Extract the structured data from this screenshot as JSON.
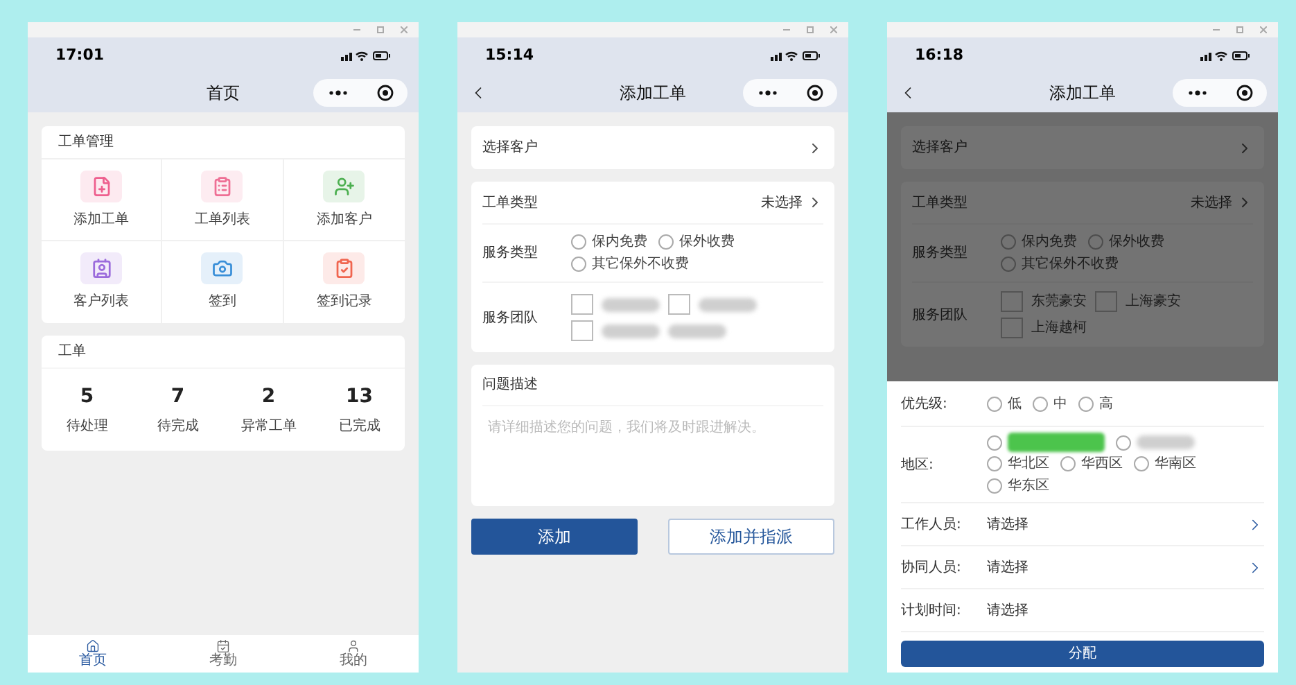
{
  "screens": [
    {
      "kind": "home",
      "status_time": "17:01",
      "title": "首页",
      "management": {
        "title": "工单管理",
        "items": [
          {
            "label": "添加工单",
            "color": "#ee5f8e"
          },
          {
            "label": "工单列表",
            "color": "#ee6f95"
          },
          {
            "label": "添加客户",
            "color": "#4caf50"
          },
          {
            "label": "客户列表",
            "color": "#9b6bdc"
          },
          {
            "label": "签到",
            "color": "#3a8fd8"
          },
          {
            "label": "签到记录",
            "color": "#f0654f"
          }
        ]
      },
      "orders": {
        "title": "工单",
        "stats": [
          {
            "value": "5",
            "label": "待处理"
          },
          {
            "value": "7",
            "label": "待完成"
          },
          {
            "value": "2",
            "label": "异常工单"
          },
          {
            "value": "13",
            "label": "已完成"
          }
        ]
      },
      "tabs": [
        {
          "label": "首页",
          "selected": true
        },
        {
          "label": "考勤",
          "selected": false
        },
        {
          "label": "我的",
          "selected": false
        }
      ]
    },
    {
      "kind": "form",
      "status_time": "15:14",
      "title": "添加工单",
      "customer": {
        "label": "选择客户"
      },
      "order_type": {
        "label": "工单类型",
        "value": "未选择"
      },
      "service_type": {
        "label": "服务类型",
        "options": [
          {
            "label": "保内免费",
            "selected": false
          },
          {
            "label": "保外收费",
            "selected": false
          },
          {
            "label": "其它保外不收费",
            "selected": false
          }
        ]
      },
      "team": {
        "label": "服务团队",
        "options": [
          {
            "kind": "redacted",
            "checked": false
          },
          {
            "kind": "redacted",
            "checked": false
          },
          {
            "kind": "redacted",
            "checked": false
          }
        ]
      },
      "description": {
        "label": "问题描述",
        "placeholder": "请详细描述您的问题，我们将及时跟进解决。"
      },
      "buttons": [
        {
          "label": "添加",
          "kind": "primary"
        },
        {
          "label": "添加并指派",
          "kind": "outline"
        }
      ]
    },
    {
      "kind": "assign",
      "status_time": "16:18",
      "title": "添加工单",
      "customer": {
        "label": "选择客户"
      },
      "order_type": {
        "label": "工单类型",
        "value": "未选择"
      },
      "service_type": {
        "label": "服务类型",
        "options": [
          {
            "label": "保内免费",
            "selected": false
          },
          {
            "label": "保外收费",
            "selected": false
          },
          {
            "label": "其它保外不收费",
            "selected": false
          }
        ]
      },
      "team": {
        "label": "服务团队",
        "options": [
          {
            "kind": "text",
            "label": "东莞豪安",
            "checked": false
          },
          {
            "kind": "text",
            "label": "上海豪安",
            "checked": false
          },
          {
            "kind": "text",
            "label": "上海越柯",
            "checked": false
          }
        ]
      },
      "sheet": {
        "priority": {
          "label": "优先级:",
          "options": [
            {
              "label": "低",
              "selected": false
            },
            {
              "label": "中",
              "selected": false
            },
            {
              "label": "高",
              "selected": false
            }
          ]
        },
        "region": {
          "label": "地区:",
          "options": [
            {
              "kind": "redacted_highlight",
              "selected": false
            },
            {
              "kind": "redacted",
              "selected": false
            },
            {
              "kind": "text",
              "label": "华北区",
              "selected": false
            },
            {
              "kind": "text",
              "label": "华西区",
              "selected": false
            },
            {
              "kind": "text",
              "label": "华南区",
              "selected": false
            },
            {
              "kind": "text",
              "label": "华东区",
              "selected": false
            }
          ]
        },
        "pickers": [
          {
            "label": "工作人员:",
            "value": "请选择",
            "arrow": true
          },
          {
            "label": "协同人员:",
            "value": "请选择",
            "arrow": true
          },
          {
            "label": "计划时间:",
            "value": "请选择",
            "arrow": false
          }
        ],
        "button": "分配"
      }
    }
  ]
}
